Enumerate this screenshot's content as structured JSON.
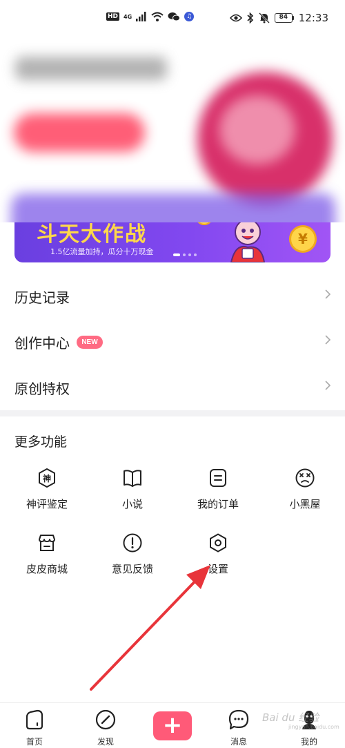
{
  "status_bar": {
    "hd": "HD",
    "network": "4G",
    "battery": "84",
    "time": "12:33",
    "icons": [
      "signal-icon",
      "wifi-icon",
      "wechat-icon",
      "music-icon",
      "eye-icon",
      "bluetooth-icon",
      "mute-icon",
      "battery-icon"
    ]
  },
  "banner": {
    "title": "斗天大作战",
    "subtitle": "1.5亿流量加持，瓜分十万现金",
    "coin_symbol": "¥"
  },
  "menu": {
    "items": [
      {
        "label": "历史记录"
      },
      {
        "label": "创作中心",
        "badge": "NEW"
      },
      {
        "label": "原创特权"
      }
    ]
  },
  "more": {
    "title": "更多功能",
    "items": [
      {
        "label": "神评鉴定",
        "icon": "shen-badge-icon",
        "glyph": "神"
      },
      {
        "label": "小说",
        "icon": "book-icon"
      },
      {
        "label": "我的订单",
        "icon": "order-icon"
      },
      {
        "label": "小黑屋",
        "icon": "dizzy-face-icon"
      },
      {
        "label": "皮皮商城",
        "icon": "shop-icon"
      },
      {
        "label": "意见反馈",
        "icon": "feedback-icon"
      },
      {
        "label": "设置",
        "icon": "settings-icon"
      }
    ]
  },
  "bottom_nav": {
    "items": [
      {
        "label": "首页",
        "icon": "home-icon"
      },
      {
        "label": "发现",
        "icon": "compass-icon"
      },
      {
        "label": "",
        "icon": "plus-icon",
        "glyph": "+"
      },
      {
        "label": "消息",
        "icon": "message-icon"
      },
      {
        "label": "我的",
        "icon": "profile-icon"
      }
    ]
  },
  "watermark": {
    "text": "Bai du 经验",
    "sub": "jingyan.baidu.com"
  },
  "colors": {
    "accent": "#ff5a78",
    "badge": "#ff6b83",
    "banner": "#7d4ded",
    "arrow": "#e8343a"
  }
}
